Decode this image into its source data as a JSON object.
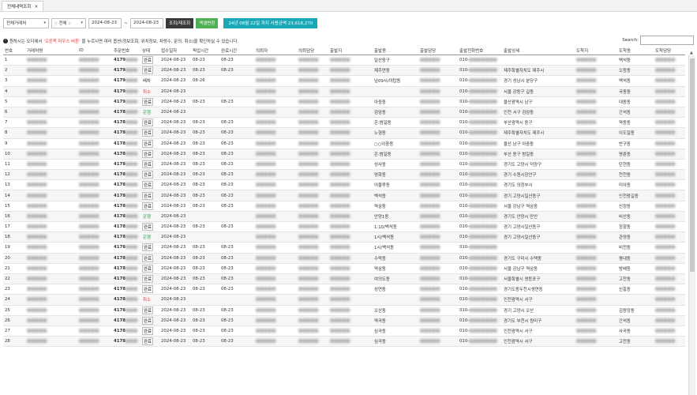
{
  "tab": {
    "title": "전체내역조회",
    "close": "×"
  },
  "filters": {
    "client": "전체거래처",
    "status": ":: 전체 ::",
    "date_from": "2024-08-23",
    "date_sep": "~",
    "date_to": "2024-08-23",
    "search_btn": "조회/재조회",
    "excel_btn": "엑셀변환",
    "summary": "24년 08월 22일 까지 사용금액 23,618,270"
  },
  "notice": {
    "pre": "원하시는 오더에서",
    "red": "'오른쪽 마우스 버튼'",
    "post": "을 누르시면 여러 옵션(정보조회, 위치정보, 차량수, 문의, 취소)을 확인하실 수 있습니다."
  },
  "search": {
    "label": "Search:"
  },
  "columns": [
    "번호",
    "거래처명",
    "ID",
    "주문번호",
    "상태",
    "접수일자",
    "픽업시간",
    "완료시간",
    "의뢰자",
    "의뢰담당",
    "출발지",
    "출발동",
    "출발담당",
    "출발전화번호",
    "출발상세",
    "도착지",
    "도착동",
    "도착담당"
  ],
  "rows": [
    {
      "no": "1",
      "order": "4179",
      "status": "완료",
      "date": "2024-08-23",
      "pickup": "08-23",
      "done": "08-23",
      "from_dong": "일산동구",
      "to_dong": "백석동"
    },
    {
      "no": "2",
      "order": "4179",
      "status": "완료",
      "date": "2024-08-23",
      "pickup": "08-23",
      "done": "08-23",
      "from_dong": "제주연동",
      "from_detail": "제주특별자치도 제주시",
      "to_dong": "오등동"
    },
    {
      "no": "3",
      "order": "4179",
      "status": "배차",
      "date": "2024-08-23",
      "pickup": "08-26",
      "done": "",
      "from_dong": "남09시/야탑동",
      "from_detail": "경기 성남시 분당구",
      "to_dong": "백석동"
    },
    {
      "no": "4",
      "order": "4179",
      "status": "취소",
      "date": "2024-08-23",
      "pickup": "",
      "done": "",
      "from_dong": "",
      "from_detail": "서울 강동구 길동",
      "to_dong": "국동동"
    },
    {
      "no": "5",
      "order": "4179",
      "status": "완료",
      "date": "2024-08-23",
      "pickup": "08-23",
      "done": "08-23",
      "from_dong": "아중동",
      "from_detail": "울산광역시 남구",
      "to_dong": "대동동"
    },
    {
      "no": "6",
      "order": "4178",
      "status": "운행",
      "date": "2024-08-23",
      "pickup": "",
      "done": "",
      "from_dong": "검암동",
      "from_detail": "인천 서구 검암동",
      "to_dong": "간석동"
    },
    {
      "no": "7",
      "order": "4178",
      "status": "완료",
      "date": "2024-08-23",
      "pickup": "08-23",
      "done": "08-23",
      "from_dong": "온.범일동",
      "from_detail": "부산광역시 동구",
      "to_dong": "역동동"
    },
    {
      "no": "8",
      "order": "4178",
      "status": "완료",
      "date": "2024-08-23",
      "pickup": "08-23",
      "done": "08-23",
      "from_dong": "노형동",
      "from_detail": "제주특별자치도 제주시",
      "to_dong": "이도일동"
    },
    {
      "no": "9",
      "order": "4178",
      "status": "완료",
      "date": "2024-08-23",
      "pickup": "08-23",
      "done": "08-23",
      "from_dong": "○○아중동",
      "from_detail": "울산 남구 아중동",
      "to_dong": "반구동"
    },
    {
      "no": "10",
      "order": "4178",
      "status": "완료",
      "date": "2024-08-23",
      "pickup": "08-23",
      "done": "08-23",
      "from_dong": "온.범일동",
      "from_detail": "부산 동구 범일동",
      "to_dong": "명륜동"
    },
    {
      "no": "11",
      "order": "4178",
      "status": "완료",
      "date": "2024-08-23",
      "pickup": "08-23",
      "done": "08-23",
      "from_dong": "성사동",
      "from_detail": "경기도 고양시 덕양구",
      "to_dong": "탄현동"
    },
    {
      "no": "12",
      "order": "4178",
      "status": "완료",
      "date": "2024-08-23",
      "pickup": "08-23",
      "done": "08-23",
      "from_dong": "영화동",
      "from_detail": "경기 수원시장안구",
      "to_dong": "천천동"
    },
    {
      "no": "13",
      "order": "4178",
      "status": "완료",
      "date": "2024-08-23",
      "pickup": "08-23",
      "done": "08-23",
      "from_dong": "어울루동",
      "from_detail": "경기도 의정부시",
      "to_dong": "미아동"
    },
    {
      "no": "14",
      "order": "4178",
      "status": "완료",
      "date": "2024-08-23",
      "pickup": "08-23",
      "done": "08-23",
      "from_dong": "백석동",
      "from_detail": "경기 고양시일산동구",
      "to_dong": "인천왕길동"
    },
    {
      "no": "15",
      "order": "4178",
      "status": "완료",
      "date": "2024-08-23",
      "pickup": "08-23",
      "done": "08-23",
      "from_dong": "역삼동",
      "from_detail": "서울 강남구 역삼동",
      "to_dong": "신정동"
    },
    {
      "no": "16",
      "order": "4178",
      "status": "운행",
      "date": "2024-08-23",
      "pickup": "",
      "done": "",
      "from_dong": "안양1동",
      "from_detail": "경기도 안양시 만안",
      "to_dong": "비산동"
    },
    {
      "no": "17",
      "order": "4178",
      "status": "완료",
      "date": "2024-08-23",
      "pickup": "08-23",
      "done": "08-23",
      "from_dong": "1:10/백석동",
      "from_detail": "경기 고양시일산동구",
      "to_dong": "장항동"
    },
    {
      "no": "18",
      "order": "4178",
      "status": "운행",
      "date": "2024-08-23",
      "pickup": "",
      "done": "",
      "from_dong": "1시/백석동",
      "from_detail": "경기 고양시일산동구",
      "to_dong": "관양동"
    },
    {
      "no": "19",
      "order": "4178",
      "status": "완료",
      "date": "2024-08-23",
      "pickup": "08-23",
      "done": "08-23",
      "from_dong": "1시/백석동",
      "from_detail": "",
      "to_dong": "비전동"
    },
    {
      "no": "20",
      "order": "4178",
      "status": "완료",
      "date": "2024-08-23",
      "pickup": "08-23",
      "done": "08-23",
      "from_dong": "수락동",
      "from_detail": "경기도 구리시 수택동",
      "to_dong": "평내동"
    },
    {
      "no": "21",
      "order": "4178",
      "status": "완료",
      "date": "2024-08-23",
      "pickup": "08-23",
      "done": "08-23",
      "from_dong": "역삼동",
      "from_detail": "서울 강남구 역삼동",
      "to_dong": "방배동"
    },
    {
      "no": "22",
      "order": "4178",
      "status": "완료",
      "date": "2024-08-23",
      "pickup": "08-23",
      "done": "08-23",
      "from_dong": "여의도동",
      "from_detail": "서울특별시 영등포구",
      "to_dong": "고잔동"
    },
    {
      "no": "23",
      "order": "4178",
      "status": "완료",
      "date": "2024-08-23",
      "pickup": "08-23",
      "done": "08-23",
      "from_dong": "성연동",
      "from_detail": "경기도동두천시생연동",
      "to_dong": "신흥동"
    },
    {
      "no": "24",
      "order": "4178",
      "status": "취소",
      "date": "2024-08-23",
      "pickup": "",
      "done": "",
      "from_dong": "",
      "from_detail": "인천광역시 서구",
      "to_dong": ""
    },
    {
      "no": "25",
      "order": "4178",
      "status": "완료",
      "date": "2024-08-23",
      "pickup": "08-23",
      "done": "08-23",
      "from_dong": "오산동",
      "from_detail": "경기 고양시 오산",
      "to_dong": "김량장동"
    },
    {
      "no": "26",
      "order": "4178",
      "status": "완료",
      "date": "2024-08-23",
      "pickup": "08-23",
      "done": "08-23",
      "from_dong": "역곡동",
      "from_detail": "경기도 부천시 원미구",
      "to_dong": "간석동"
    },
    {
      "no": "27",
      "order": "4178",
      "status": "완료",
      "date": "2024-08-23",
      "pickup": "08-23",
      "done": "08-23",
      "from_dong": "심곡동",
      "from_detail": "인천광역시 서구",
      "to_dong": "사곡동"
    },
    {
      "no": "28",
      "order": "4178",
      "status": "완료",
      "date": "2024-08-23",
      "pickup": "08-23",
      "done": "08-23",
      "from_dong": "심곡동",
      "from_detail": "인천광역시 서구",
      "to_dong": "고잔동"
    }
  ],
  "colors": {
    "accent_teal": "#1aa8b8",
    "accent_green": "#4caf50",
    "status_cancel": "#e53935",
    "status_dispatch": "#2e9e4e"
  }
}
